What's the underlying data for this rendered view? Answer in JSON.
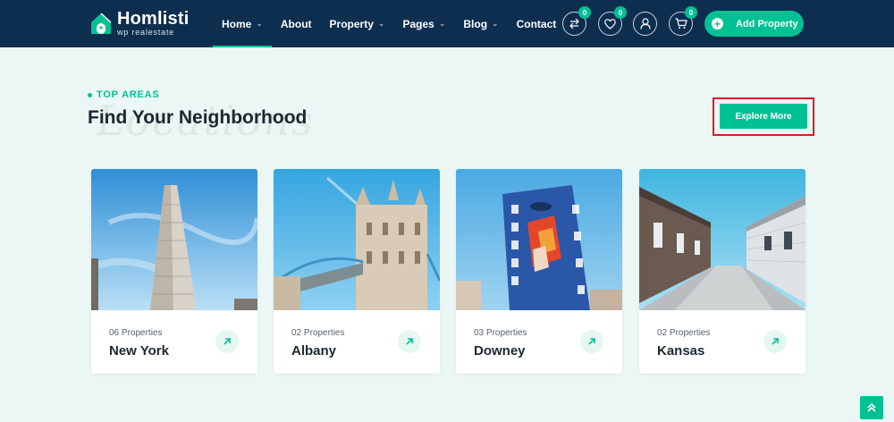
{
  "brand": {
    "name": "Homlisti",
    "tagline": "wp realestate"
  },
  "nav": [
    {
      "label": "Home",
      "dropdown": true,
      "active": true
    },
    {
      "label": "About",
      "dropdown": false
    },
    {
      "label": "Property",
      "dropdown": true
    },
    {
      "label": "Pages",
      "dropdown": true
    },
    {
      "label": "Blog",
      "dropdown": true
    },
    {
      "label": "Contact",
      "dropdown": false
    }
  ],
  "header_actions": {
    "compare": {
      "icon": "compare-arrows-icon",
      "count": "0"
    },
    "favorites": {
      "icon": "heart-icon",
      "count": "0"
    },
    "account": {
      "icon": "user-icon"
    },
    "cart": {
      "icon": "cart-icon",
      "count": "0"
    },
    "add_property": {
      "label": "Add Property"
    }
  },
  "section": {
    "eyebrow": "TOP AREAS",
    "title": "Find Your Neighborhood",
    "script_watermark": "Locations",
    "explore_label": "Explore More"
  },
  "areas": [
    {
      "count": "06 Properties",
      "city": "New York"
    },
    {
      "count": "02 Properties",
      "city": "Albany"
    },
    {
      "count": "03 Properties",
      "city": "Downey"
    },
    {
      "count": "02 Properties",
      "city": "Kansas"
    }
  ],
  "colors": {
    "accent": "#00c194",
    "navy": "#0e2e50",
    "background": "#ebf7f4",
    "highlight": "#e01b24"
  }
}
